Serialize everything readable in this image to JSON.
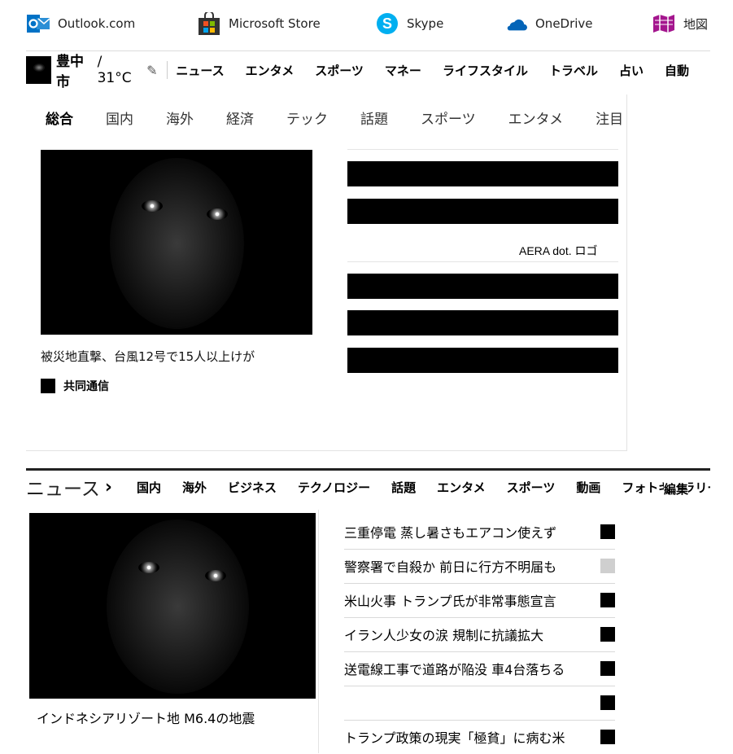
{
  "services": [
    {
      "label": "Outlook.com",
      "icon": "outlook-icon",
      "color": "#0072c6"
    },
    {
      "label": "Microsoft Store",
      "icon": "store-icon",
      "color": "#333333"
    },
    {
      "label": "Skype",
      "icon": "skype-icon",
      "color": "#00aff0"
    },
    {
      "label": "OneDrive",
      "icon": "onedrive-icon",
      "color": "#0364b8"
    },
    {
      "label": "地図",
      "icon": "map-icon",
      "color": "#a4168e"
    }
  ],
  "weather": {
    "city": "豊中市",
    "temp": "/ 31°C",
    "edit_icon": "pencil-icon"
  },
  "main_nav": [
    "ニュース",
    "エンタメ",
    "スポーツ",
    "マネー",
    "ライフスタイル",
    "トラベル",
    "占い",
    "自動"
  ],
  "top_tabs": {
    "active": "総合",
    "items": [
      "総合",
      "国内",
      "海外",
      "経済",
      "テック",
      "話題",
      "スポーツ",
      "エンタメ",
      "注目"
    ]
  },
  "hero": {
    "caption": "被災地直撃、台風12号で15人以上けが",
    "source": "共同通信"
  },
  "right_panel": {
    "logo_alt": "AERA dot. ロゴ"
  },
  "news_section": {
    "title": "ニュース",
    "chevron": "›",
    "tabs": [
      "国内",
      "海外",
      "ビジネス",
      "テクノロジー",
      "話題",
      "エンタメ",
      "スポーツ",
      "動画",
      "フォトギャラリー"
    ],
    "edit_label": "編集",
    "lead_caption": "インドネシアリゾート地 M6.4の地震",
    "items": [
      {
        "title": "三重停電 蒸し暑さもエアコン使えず",
        "thumb": "dark"
      },
      {
        "title": "警察署で自殺か 前日に行方不明届も",
        "thumb": "grey"
      },
      {
        "title": "米山火事 トランプ氏が非常事態宣言",
        "thumb": "dark"
      },
      {
        "title": "イラン人少女の涙 規制に抗議拡大",
        "thumb": "dark"
      },
      {
        "title": "送電線工事で道路が陥没 車4台落ちる",
        "thumb": "dark"
      },
      {
        "title": "",
        "thumb": "dark"
      },
      {
        "title": "トランプ政策の現実「極貧」に病む米",
        "thumb": "dark"
      }
    ]
  }
}
